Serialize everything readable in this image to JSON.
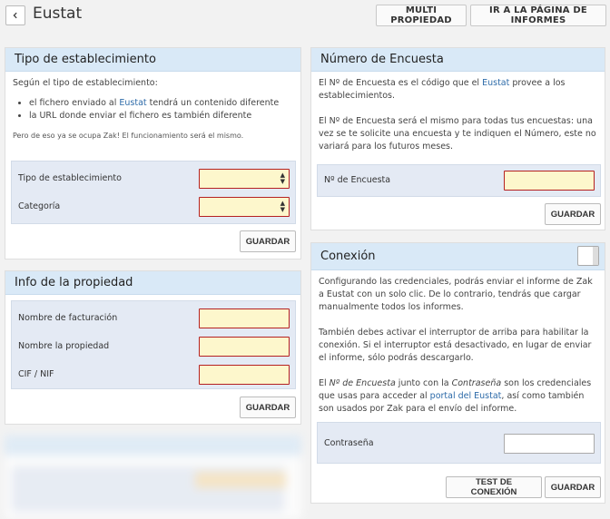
{
  "header": {
    "title": "Eustat",
    "btn_multi": "MULTI PROPIEDAD",
    "btn_reports": "IR A LA PÁGINA DE INFORMES"
  },
  "tipo": {
    "title": "Tipo de establecimiento",
    "intro": "Según el tipo de establecimiento:",
    "bullet1_a": "el fichero enviado al ",
    "bullet1_link": "Eustat",
    "bullet1_b": " tendrá un contenido diferente",
    "bullet2": "la URL donde enviar el fichero es también diferente",
    "note": "Pero de eso ya se ocupa Zak! El funcionamiento será el mismo.",
    "label_tipo": "Tipo de establecimiento",
    "label_categoria": "Categoría",
    "save": "GUARDAR"
  },
  "info": {
    "title": "Info de la propiedad",
    "label_facturacion": "Nombre de facturación",
    "label_propiedad": "Nombre la propiedad",
    "label_cif": "CIF / NIF",
    "save": "GUARDAR"
  },
  "encuesta": {
    "title": "Número de Encuesta",
    "p1_a": "El Nº de Encuesta es el código que el ",
    "p1_link": "Eustat",
    "p1_b": " provee a los establecimientos.",
    "p2": "El Nº de Encuesta será el mismo para todas tus encuestas: una vez se te solicite una encuesta y te indiquen el Número, este no variará para los futuros meses.",
    "label": "Nº de Encuesta",
    "save": "GUARDAR"
  },
  "conexion": {
    "title": "Conexión",
    "p1": "Configurando las credenciales, podrás enviar el informe de Zak a Eustat con un solo clic. De lo contrario, tendrás que cargar manualmente todos los informes.",
    "p2": "También debes activar el interruptor de arriba para habilitar la conexión. Si el interruptor está desactivado, en lugar de enviar el informe, sólo podrás descargarlo.",
    "p3_a": "El ",
    "p3_em1": "Nº de Encuesta",
    "p3_b": " junto con la ",
    "p3_em2": "Contraseña",
    "p3_c": " son los credenciales que usas para acceder al ",
    "p3_link": "portal del Eustat",
    "p3_d": ", así como también son usados por Zak para el envío del informe.",
    "label_pass": "Contraseña",
    "test": "TEST DE CONEXIÓN",
    "save": "GUARDAR"
  }
}
